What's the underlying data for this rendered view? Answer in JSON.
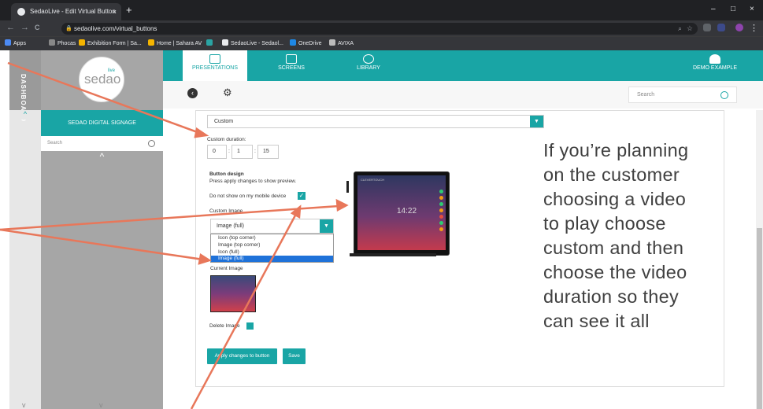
{
  "browser": {
    "tab_title": "SedaoLive - Edit Virtual Button",
    "tab_close": "×",
    "new_tab": "+",
    "url": "sedaolive.com/virtual_buttons",
    "back": "←",
    "forward": "→",
    "reload": "C",
    "window_min": "–",
    "window_max": "□",
    "window_close": "×",
    "menu": "⋮",
    "bookmarks": [
      {
        "label": "Apps",
        "color": "#4c8bf5"
      },
      {
        "label": "Phocas",
        "color": "#888888"
      },
      {
        "label": "Exhibition Form | Sa...",
        "color": "#f4b400"
      },
      {
        "label": "Home | Sahara AV",
        "color": "#f4b400"
      },
      {
        "label": "",
        "color": "#2aa4a4"
      },
      {
        "label": "SedaoLive - Sedaol...",
        "color": "#e8eaed"
      },
      {
        "label": "OneDrive",
        "color": "#1e88e5"
      },
      {
        "label": "AVIXA",
        "color": "#bbbbbb"
      }
    ]
  },
  "sidebar": {
    "dashboard_label": "DASHBOARD",
    "logo_text": "sedao",
    "logo_live": "live",
    "section_title": "SEDAO DIGITAL SIGNAGE",
    "search_placeholder": "Search",
    "up_arrow": "^",
    "collapse_arrow": "^",
    "bottom_arrow_left": "v",
    "bottom_arrow_right": "v"
  },
  "topnav": {
    "tabs": [
      {
        "label": "PRESENTATIONS",
        "active": true
      },
      {
        "label": "SCREENS",
        "active": false
      },
      {
        "label": "LIBRARY",
        "active": false
      }
    ],
    "user_label": "DEMO EXAMPLE",
    "search_placeholder": "Search"
  },
  "form": {
    "duration_select": "Custom",
    "custom_duration_label": "Custom duration:",
    "duration_values": [
      "0",
      "1",
      "15"
    ],
    "colon": ":",
    "button_design_title": "Button design",
    "button_design_hint": "Press apply changes to show preview.",
    "mobile_label": "Do not show on my mobile device",
    "mobile_checked": "✓",
    "custom_image_label": "Custom Image",
    "image_select_value": "Image (full)",
    "image_options": [
      {
        "label": "Icon (top corner)",
        "selected": false
      },
      {
        "label": "Image (top corner)",
        "selected": false
      },
      {
        "label": "Icon (full)",
        "selected": false
      },
      {
        "label": "Image (full)",
        "selected": true
      }
    ],
    "current_image_label": "Current Image",
    "delete_image_label": "Delete Image",
    "apply_button": "Apply changes to button",
    "save_button": "Save"
  },
  "preview": {
    "clock": "14:22",
    "brand": "CLEVERTOUCH"
  },
  "annotation": {
    "note_lines": [
      "If you’re planning",
      "on the customer",
      "choosing a video",
      "to play choose",
      "custom and then",
      "choose the video",
      "duration so they",
      "can see it all"
    ],
    "arrow_color": "#e8775a"
  },
  "colors": {
    "accent": "#19a5a5",
    "selection": "#1f72d9"
  }
}
